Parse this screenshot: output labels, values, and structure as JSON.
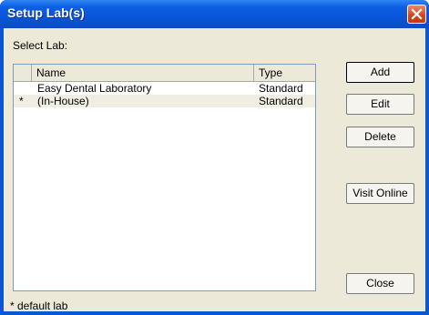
{
  "window": {
    "title": "Setup Lab(s)"
  },
  "labels": {
    "select_lab": "Select Lab:",
    "footnote": "* default lab"
  },
  "list": {
    "columns": [
      {
        "label": "Name"
      },
      {
        "label": "Type"
      }
    ],
    "rows": [
      {
        "marker": "",
        "name": "Easy Dental Laboratory",
        "type": "Standard"
      },
      {
        "marker": "*",
        "name": "(In-House)",
        "type": "Standard"
      }
    ]
  },
  "buttons": {
    "add": "Add",
    "edit": "Edit",
    "delete": "Delete",
    "visit_online": "Visit Online",
    "close": "Close"
  },
  "colors": {
    "titlebar": "#0a55d9",
    "dialog_bg": "#ece9d8",
    "close_button": "#d2451c"
  }
}
